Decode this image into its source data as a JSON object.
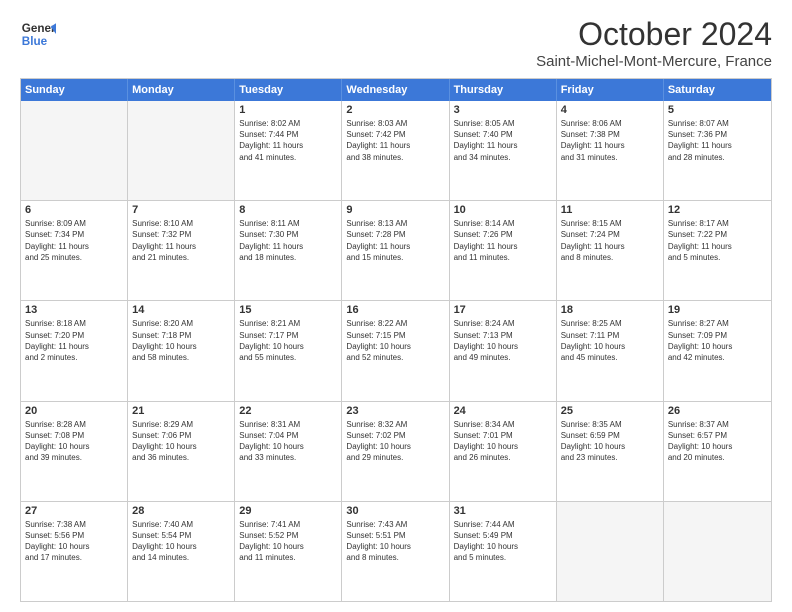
{
  "header": {
    "logo_general": "General",
    "logo_blue": "Blue",
    "month": "October 2024",
    "location": "Saint-Michel-Mont-Mercure, France"
  },
  "weekdays": [
    "Sunday",
    "Monday",
    "Tuesday",
    "Wednesday",
    "Thursday",
    "Friday",
    "Saturday"
  ],
  "rows": [
    [
      {
        "day": "",
        "empty": true,
        "lines": []
      },
      {
        "day": "",
        "empty": true,
        "lines": []
      },
      {
        "day": "1",
        "empty": false,
        "lines": [
          "Sunrise: 8:02 AM",
          "Sunset: 7:44 PM",
          "Daylight: 11 hours",
          "and 41 minutes."
        ]
      },
      {
        "day": "2",
        "empty": false,
        "lines": [
          "Sunrise: 8:03 AM",
          "Sunset: 7:42 PM",
          "Daylight: 11 hours",
          "and 38 minutes."
        ]
      },
      {
        "day": "3",
        "empty": false,
        "lines": [
          "Sunrise: 8:05 AM",
          "Sunset: 7:40 PM",
          "Daylight: 11 hours",
          "and 34 minutes."
        ]
      },
      {
        "day": "4",
        "empty": false,
        "lines": [
          "Sunrise: 8:06 AM",
          "Sunset: 7:38 PM",
          "Daylight: 11 hours",
          "and 31 minutes."
        ]
      },
      {
        "day": "5",
        "empty": false,
        "lines": [
          "Sunrise: 8:07 AM",
          "Sunset: 7:36 PM",
          "Daylight: 11 hours",
          "and 28 minutes."
        ]
      }
    ],
    [
      {
        "day": "6",
        "empty": false,
        "lines": [
          "Sunrise: 8:09 AM",
          "Sunset: 7:34 PM",
          "Daylight: 11 hours",
          "and 25 minutes."
        ]
      },
      {
        "day": "7",
        "empty": false,
        "lines": [
          "Sunrise: 8:10 AM",
          "Sunset: 7:32 PM",
          "Daylight: 11 hours",
          "and 21 minutes."
        ]
      },
      {
        "day": "8",
        "empty": false,
        "lines": [
          "Sunrise: 8:11 AM",
          "Sunset: 7:30 PM",
          "Daylight: 11 hours",
          "and 18 minutes."
        ]
      },
      {
        "day": "9",
        "empty": false,
        "lines": [
          "Sunrise: 8:13 AM",
          "Sunset: 7:28 PM",
          "Daylight: 11 hours",
          "and 15 minutes."
        ]
      },
      {
        "day": "10",
        "empty": false,
        "lines": [
          "Sunrise: 8:14 AM",
          "Sunset: 7:26 PM",
          "Daylight: 11 hours",
          "and 11 minutes."
        ]
      },
      {
        "day": "11",
        "empty": false,
        "lines": [
          "Sunrise: 8:15 AM",
          "Sunset: 7:24 PM",
          "Daylight: 11 hours",
          "and 8 minutes."
        ]
      },
      {
        "day": "12",
        "empty": false,
        "lines": [
          "Sunrise: 8:17 AM",
          "Sunset: 7:22 PM",
          "Daylight: 11 hours",
          "and 5 minutes."
        ]
      }
    ],
    [
      {
        "day": "13",
        "empty": false,
        "lines": [
          "Sunrise: 8:18 AM",
          "Sunset: 7:20 PM",
          "Daylight: 11 hours",
          "and 2 minutes."
        ]
      },
      {
        "day": "14",
        "empty": false,
        "lines": [
          "Sunrise: 8:20 AM",
          "Sunset: 7:18 PM",
          "Daylight: 10 hours",
          "and 58 minutes."
        ]
      },
      {
        "day": "15",
        "empty": false,
        "lines": [
          "Sunrise: 8:21 AM",
          "Sunset: 7:17 PM",
          "Daylight: 10 hours",
          "and 55 minutes."
        ]
      },
      {
        "day": "16",
        "empty": false,
        "lines": [
          "Sunrise: 8:22 AM",
          "Sunset: 7:15 PM",
          "Daylight: 10 hours",
          "and 52 minutes."
        ]
      },
      {
        "day": "17",
        "empty": false,
        "lines": [
          "Sunrise: 8:24 AM",
          "Sunset: 7:13 PM",
          "Daylight: 10 hours",
          "and 49 minutes."
        ]
      },
      {
        "day": "18",
        "empty": false,
        "lines": [
          "Sunrise: 8:25 AM",
          "Sunset: 7:11 PM",
          "Daylight: 10 hours",
          "and 45 minutes."
        ]
      },
      {
        "day": "19",
        "empty": false,
        "lines": [
          "Sunrise: 8:27 AM",
          "Sunset: 7:09 PM",
          "Daylight: 10 hours",
          "and 42 minutes."
        ]
      }
    ],
    [
      {
        "day": "20",
        "empty": false,
        "lines": [
          "Sunrise: 8:28 AM",
          "Sunset: 7:08 PM",
          "Daylight: 10 hours",
          "and 39 minutes."
        ]
      },
      {
        "day": "21",
        "empty": false,
        "lines": [
          "Sunrise: 8:29 AM",
          "Sunset: 7:06 PM",
          "Daylight: 10 hours",
          "and 36 minutes."
        ]
      },
      {
        "day": "22",
        "empty": false,
        "lines": [
          "Sunrise: 8:31 AM",
          "Sunset: 7:04 PM",
          "Daylight: 10 hours",
          "and 33 minutes."
        ]
      },
      {
        "day": "23",
        "empty": false,
        "lines": [
          "Sunrise: 8:32 AM",
          "Sunset: 7:02 PM",
          "Daylight: 10 hours",
          "and 29 minutes."
        ]
      },
      {
        "day": "24",
        "empty": false,
        "lines": [
          "Sunrise: 8:34 AM",
          "Sunset: 7:01 PM",
          "Daylight: 10 hours",
          "and 26 minutes."
        ]
      },
      {
        "day": "25",
        "empty": false,
        "lines": [
          "Sunrise: 8:35 AM",
          "Sunset: 6:59 PM",
          "Daylight: 10 hours",
          "and 23 minutes."
        ]
      },
      {
        "day": "26",
        "empty": false,
        "lines": [
          "Sunrise: 8:37 AM",
          "Sunset: 6:57 PM",
          "Daylight: 10 hours",
          "and 20 minutes."
        ]
      }
    ],
    [
      {
        "day": "27",
        "empty": false,
        "lines": [
          "Sunrise: 7:38 AM",
          "Sunset: 5:56 PM",
          "Daylight: 10 hours",
          "and 17 minutes."
        ]
      },
      {
        "day": "28",
        "empty": false,
        "lines": [
          "Sunrise: 7:40 AM",
          "Sunset: 5:54 PM",
          "Daylight: 10 hours",
          "and 14 minutes."
        ]
      },
      {
        "day": "29",
        "empty": false,
        "lines": [
          "Sunrise: 7:41 AM",
          "Sunset: 5:52 PM",
          "Daylight: 10 hours",
          "and 11 minutes."
        ]
      },
      {
        "day": "30",
        "empty": false,
        "lines": [
          "Sunrise: 7:43 AM",
          "Sunset: 5:51 PM",
          "Daylight: 10 hours",
          "and 8 minutes."
        ]
      },
      {
        "day": "31",
        "empty": false,
        "lines": [
          "Sunrise: 7:44 AM",
          "Sunset: 5:49 PM",
          "Daylight: 10 hours",
          "and 5 minutes."
        ]
      },
      {
        "day": "",
        "empty": true,
        "lines": []
      },
      {
        "day": "",
        "empty": true,
        "lines": []
      }
    ]
  ]
}
